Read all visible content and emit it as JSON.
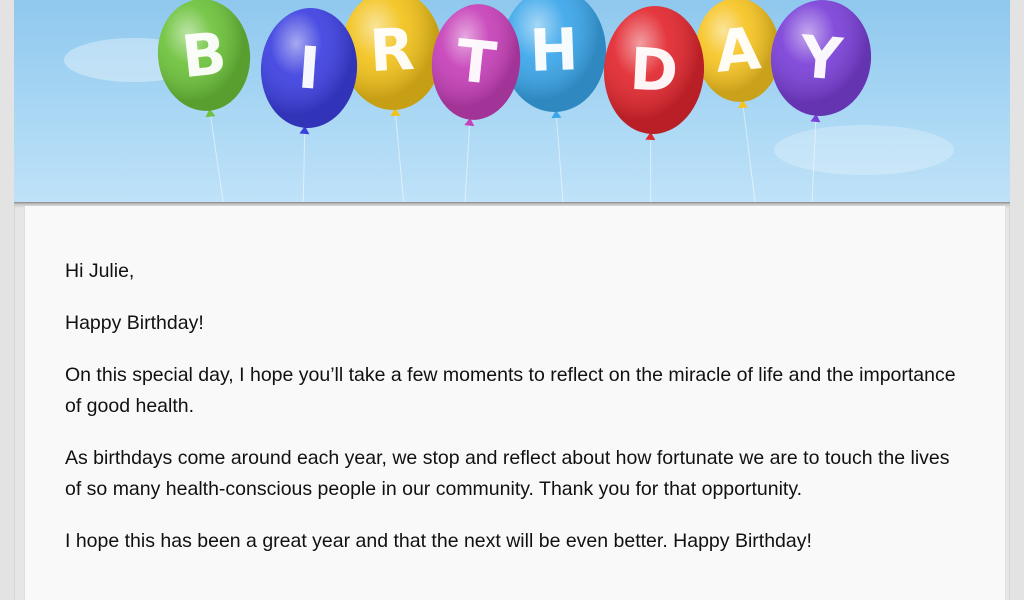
{
  "banner": {
    "letters": [
      "B",
      "I",
      "R",
      "T",
      "H",
      "D",
      "A",
      "Y"
    ],
    "balloon_colors": [
      "#6cc23a",
      "#3c3fe0",
      "#f2c21a",
      "#c63fb8",
      "#3aa6ea",
      "#e2262e",
      "#f6c421",
      "#7a3fd8"
    ]
  },
  "email": {
    "greeting": "Hi Julie,",
    "line1": "Happy Birthday!",
    "para1": "On this special day, I hope you’ll take a few moments to reflect on the miracle of life and the importance of good health.",
    "para2": "As birthdays come around each year, we stop and reflect about how fortunate we are to touch the lives of so many health-conscious people in our community. Thank you for that opportunity.",
    "para3": "I hope this has been a great year and that the next will be even better. Happy Birthday!"
  }
}
